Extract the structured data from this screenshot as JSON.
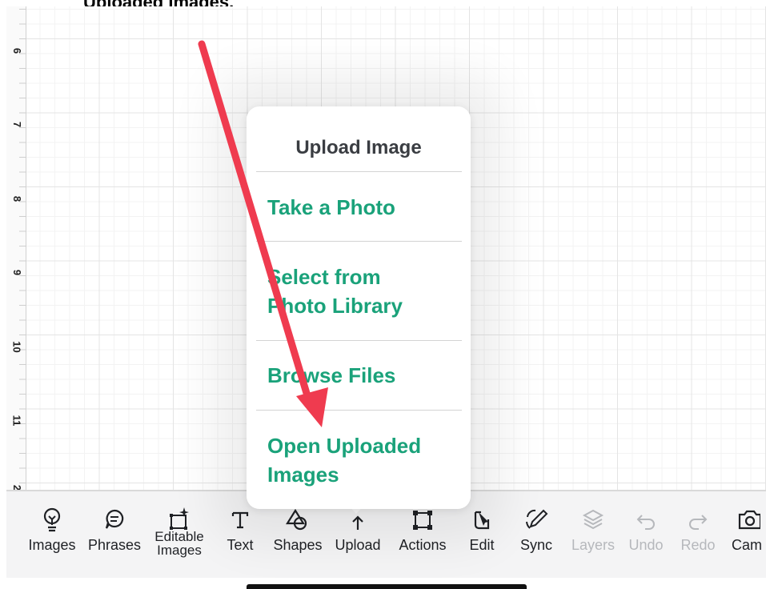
{
  "caption": "Uploaded Images.",
  "ruler": {
    "labels": [
      "6",
      "7",
      "8",
      "9",
      "10",
      "11",
      "2"
    ]
  },
  "popover": {
    "title": "Upload Image",
    "items": [
      {
        "label": "Take a Photo"
      },
      {
        "label_line1": "Select from",
        "label_line2": "Photo Library"
      },
      {
        "label": "Browse Files"
      },
      {
        "label_line1": "Open Uploaded",
        "label_line2": "Images"
      }
    ]
  },
  "toolbar": {
    "images": "Images",
    "phrases": "Phrases",
    "editable_line1": "Editable",
    "editable_line2": "Images",
    "text": "Text",
    "shapes": "Shapes",
    "upload": "Upload",
    "actions": "Actions",
    "edit": "Edit",
    "sync": "Sync",
    "layers": "Layers",
    "undo": "Undo",
    "redo": "Redo",
    "camera": "Cam"
  },
  "colors": {
    "accent_green": "#1aa27a",
    "annotation_arrow": "#ef3b4f",
    "disabled": "#b6b8bc"
  },
  "icons": {
    "images": "lightbulb-icon",
    "phrases": "chat-bubble-icon",
    "editable": "sparkle-square-icon",
    "text": "text-t-icon",
    "shapes": "shapes-icon",
    "upload": "upload-arrow-icon",
    "actions": "bounding-box-icon",
    "edit": "edit-cursor-icon",
    "sync": "pen-sync-icon",
    "layers": "layers-icon",
    "undo": "undo-icon",
    "redo": "redo-icon",
    "camera": "camera-icon"
  }
}
